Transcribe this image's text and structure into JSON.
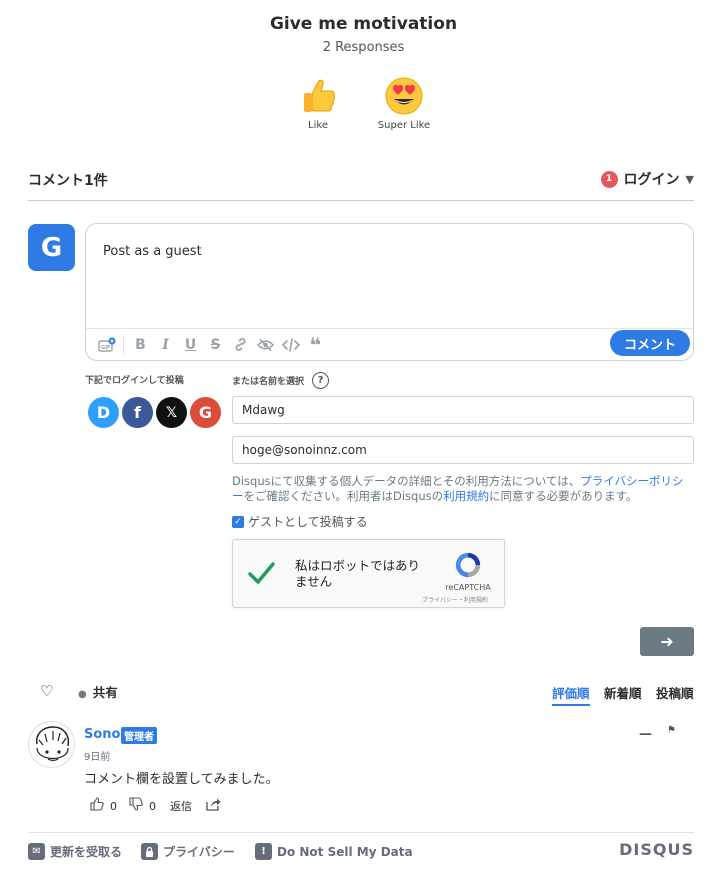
{
  "thread": {
    "title": "Give me motivation",
    "responses": "2 Responses"
  },
  "reactions": [
    {
      "label": "Like",
      "icon": "thumbs-up-emoji"
    },
    {
      "label": "Super Like",
      "icon": "heart-eyes-emoji"
    }
  ],
  "header": {
    "comment_count": "コメント1件",
    "login_label": "ログイン",
    "notification_count": "1"
  },
  "composer": {
    "avatar_letter": "G",
    "placeholder": "Post as a guest",
    "submit_label": "コメント",
    "toolbar_icons": [
      "gif-icon",
      "bold-icon",
      "italic-icon",
      "underline-icon",
      "strikethrough-icon",
      "link-icon",
      "spoiler-icon",
      "code-icon",
      "quote-icon"
    ]
  },
  "guest": {
    "login_with_label": "下記でログインして投稿",
    "or_name_label": "または名前を選択",
    "help_label": "?",
    "name_value": "Mdawg",
    "email_value": "hoge@sonoinnz.com",
    "notice_part1": "Disqusにて収集する個人データの詳細とその利用方法については、",
    "privacy_link": "プライバシーポリシー",
    "notice_part2": "をご確認ください。利用者はDisqusの",
    "terms_link": "利用規約",
    "notice_part3": "に同意する必要があります。",
    "guest_checkbox_label": "ゲストとして投稿する",
    "guest_checked": true,
    "socials": [
      {
        "name": "disqus",
        "letter": "D",
        "color": "#2e9fff"
      },
      {
        "name": "facebook",
        "letter": "f",
        "color": "#3b5998"
      },
      {
        "name": "x",
        "letter": "𝕏",
        "color": "#111111"
      },
      {
        "name": "google",
        "letter": "G",
        "color": "#dd4b39"
      }
    ]
  },
  "captcha": {
    "label": "私はロボットではありません",
    "brand": "reCAPTCHA",
    "terms": "プライバシー・利用規約"
  },
  "submit_arrow": "➜",
  "sortbar": {
    "share_label": "共有",
    "sort_options": [
      "評価順",
      "新着順",
      "投稿順"
    ],
    "active_sort": "評価順"
  },
  "comments": [
    {
      "author": "Sono",
      "badge": "管理者",
      "time": "9日前",
      "text": "コメント欄を設置してみました。",
      "upvotes": "0",
      "downvotes": "0",
      "reply_label": "返信"
    }
  ],
  "footer": {
    "subscribe_label": "更新を受取る",
    "privacy_label": "プライバシー",
    "dnsmpi_label": "Do Not Sell My Data",
    "brand": "DISQUS"
  },
  "colors": {
    "accent": "#2e7be6",
    "badge_red": "#e3585a",
    "muted": "#656c7a"
  }
}
